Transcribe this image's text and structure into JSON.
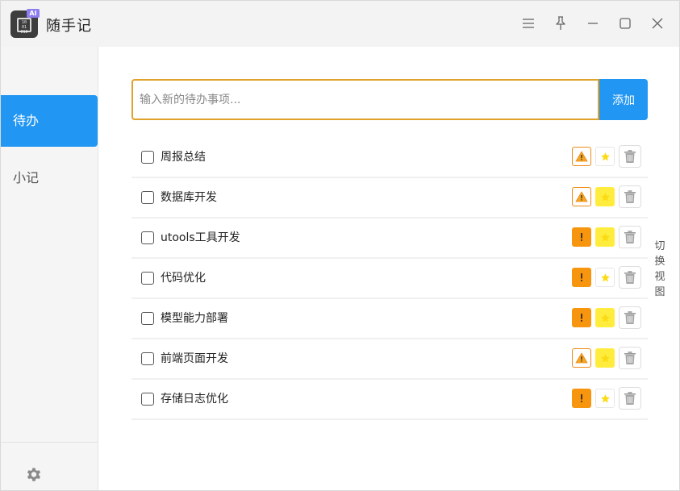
{
  "app": {
    "title": "随手记",
    "logo_badge": "AI",
    "logo_chip_text": "10 01 010"
  },
  "titlebar_icons": [
    "menu-icon",
    "pin-icon",
    "minimize-icon",
    "maximize-icon",
    "close-icon"
  ],
  "sidebar": {
    "items": [
      {
        "label": "待办",
        "active": true
      },
      {
        "label": "小记",
        "active": false
      }
    ],
    "settings_icon": "gear-icon"
  },
  "input": {
    "placeholder": "输入新的待办事项...",
    "value": ""
  },
  "add_button": "添加",
  "switch_view": "切换视图",
  "colors": {
    "accent": "#2196f3",
    "input_border": "#e0a22a",
    "priority_orange": "#f7950f",
    "star_yellow": "#ffec3d"
  },
  "todos": [
    {
      "label": "周报总结",
      "priority": "outline",
      "starred": false
    },
    {
      "label": "数据库开发",
      "priority": "outline",
      "starred": true
    },
    {
      "label": "utools工具开发",
      "priority": "filled",
      "starred": true
    },
    {
      "label": "代码优化",
      "priority": "filled",
      "starred": false
    },
    {
      "label": "模型能力部署",
      "priority": "filled",
      "starred": true
    },
    {
      "label": "前端页面开发",
      "priority": "outline",
      "starred": true
    },
    {
      "label": "存储日志优化",
      "priority": "filled",
      "starred": false
    }
  ]
}
